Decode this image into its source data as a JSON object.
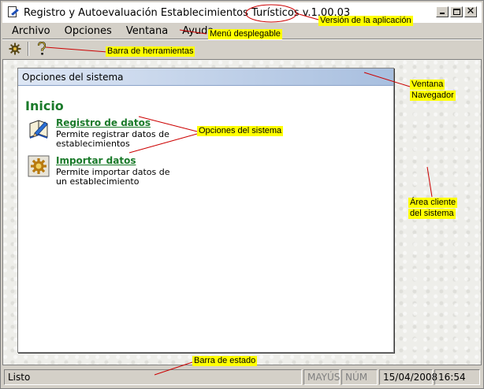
{
  "window": {
    "title": "Registro y Autoevaluación Establecimientos Turísticos",
    "version": "v.1.00.03",
    "controls": {
      "minimize": "_",
      "maximize": "□",
      "close": "✕"
    }
  },
  "menu": [
    "Archivo",
    "Opciones",
    "Ventana",
    "Ayuda"
  ],
  "toolbar": {
    "buttons": [
      "settings-gear-icon",
      "help-question-icon"
    ]
  },
  "navigator": {
    "header": "Opciones del sistema",
    "heading": "Inicio",
    "options": [
      {
        "label": "Registro de datos",
        "description": "Permite registrar datos de establecimientos",
        "icon": "book-pencil-icon"
      },
      {
        "label": "Importar datos",
        "description": "Permite importar datos de un establecimiento",
        "icon": "gear-import-icon"
      }
    ]
  },
  "statusbar": {
    "status": "Listo",
    "caps": "MAYÚS",
    "num": "NÚM",
    "date": "15/04/2008",
    "time": "16:54"
  },
  "annotations": {
    "version": "Versión de la aplicación",
    "menu": "Menú desplegable",
    "toolbar": "Barra de herramientas",
    "navigator_l1": "Ventana",
    "navigator_l2": "Navegador",
    "options": "Opciones del sistema",
    "client_l1": "Área cliente",
    "client_l2": "del sistema",
    "statusbar": "Barra de estado"
  },
  "colors": {
    "accent_green": "#1a7a2a",
    "annotation_yellow": "#ffff00",
    "header_blue": "#a8bfdf",
    "annotation_line": "#cc0000"
  }
}
